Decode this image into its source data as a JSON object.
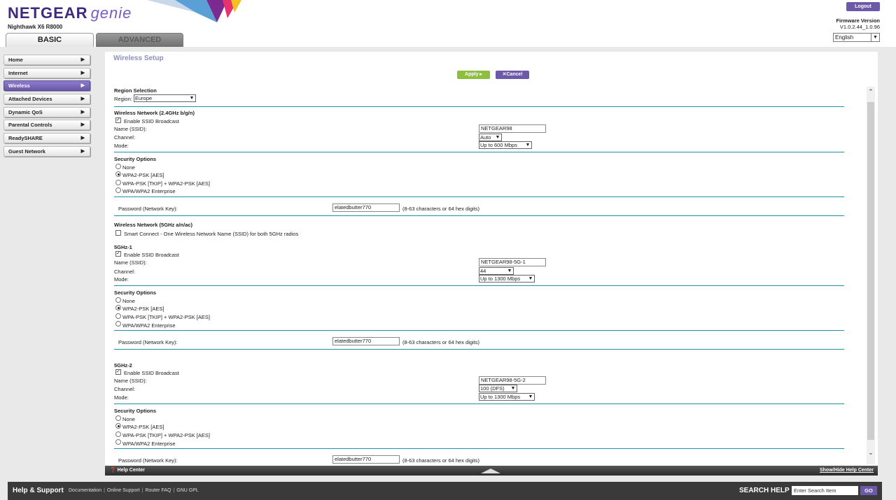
{
  "header": {
    "brand": "NETGEAR",
    "brand_product": "genie",
    "model": "Nighthawk X6 R8000",
    "tab_basic": "BASIC",
    "tab_advanced": "ADVANCED",
    "logout": "Logout",
    "firmware_label": "Firmware Version",
    "firmware_value": "V1.0.2.44_1.0.96",
    "language": "English"
  },
  "sidebar": {
    "items": [
      {
        "label": "Home"
      },
      {
        "label": "Internet"
      },
      {
        "label": "Wireless"
      },
      {
        "label": "Attached Devices"
      },
      {
        "label": "Dynamic QoS"
      },
      {
        "label": "Parental Controls"
      },
      {
        "label": "ReadySHARE"
      },
      {
        "label": "Guest Network"
      }
    ]
  },
  "main": {
    "title": "Wireless Setup",
    "apply": "Apply ▸",
    "cancel": "✕Cancel",
    "region": {
      "heading": "Region Selection",
      "label": "Region:",
      "value": "Europe"
    },
    "net24": {
      "heading": "Wireless Network (2.4GHz b/g/n)",
      "ssid_broadcast": "Enable SSID Broadcast",
      "name_label": "Name (SSID):",
      "name_value": "NETGEAR98",
      "channel_label": "Channel:",
      "channel_value": "Auto",
      "mode_label": "Mode:",
      "mode_value": "Up to 600 Mbps",
      "security_heading": "Security Options",
      "opt_none": "None",
      "opt_wpa2": "WPA2-PSK [AES]",
      "opt_mixed": "WPA-PSK [TKIP] + WPA2-PSK [AES]",
      "opt_enterprise": "WPA/WPA2 Enterprise",
      "password_label": "Password (Network Key):",
      "password_value": "elatedbutter770",
      "password_hint": "(8-63 characters or 64 hex digits)"
    },
    "net5": {
      "heading": "Wireless Network (5GHz a/n/ac)",
      "smart_connect": "Smart Connect - One Wireless Network Name (SSID) for both 5GHz radios"
    },
    "g1": {
      "heading": "5GHz-1",
      "ssid_broadcast": "Enable SSID Broadcast",
      "name_label": "Name (SSID):",
      "name_value": "NETGEAR98-5G-1",
      "channel_label": "Channel:",
      "channel_value": "44",
      "mode_label": "Mode:",
      "mode_value": "Up to 1300 Mbps",
      "security_heading": "Security Options",
      "opt_none": "None",
      "opt_wpa2": "WPA2-PSK [AES]",
      "opt_mixed": "WPA-PSK [TKIP] + WPA2-PSK [AES]",
      "opt_enterprise": "WPA/WPA2 Enterprise",
      "password_label": "Password (Network Key):",
      "password_value": "elatedbutter770",
      "password_hint": "(8-63 characters or 64 hex digits)"
    },
    "g2": {
      "heading": "5GHz-2",
      "ssid_broadcast": "Enable SSID Broadcast",
      "name_label": "Name (SSID):",
      "name_value": "NETGEAR98-5G-2",
      "channel_label": "Channel:",
      "channel_value": "100 (DFS)",
      "mode_label": "Mode:",
      "mode_value": "Up to 1300 Mbps",
      "security_heading": "Security Options",
      "opt_none": "None",
      "opt_wpa2": "WPA2-PSK [AES]",
      "opt_mixed": "WPA-PSK [TKIP] + WPA2-PSK [AES]",
      "opt_enterprise": "WPA/WPA2 Enterprise",
      "password_label": "Password (Network Key):",
      "password_value": "elatedbutter770",
      "password_hint": "(8-63 characters or 64 hex digits)"
    }
  },
  "helpbar": {
    "left": "Help Center",
    "right": "Show/Hide Help Center"
  },
  "footer": {
    "title": "Help & Support",
    "links": [
      "Documentation",
      "Online Support",
      "Router FAQ",
      "GNU GPL"
    ],
    "search_label": "SEARCH HELP",
    "search_placeholder": "Enter Search Item",
    "go": "GO"
  }
}
